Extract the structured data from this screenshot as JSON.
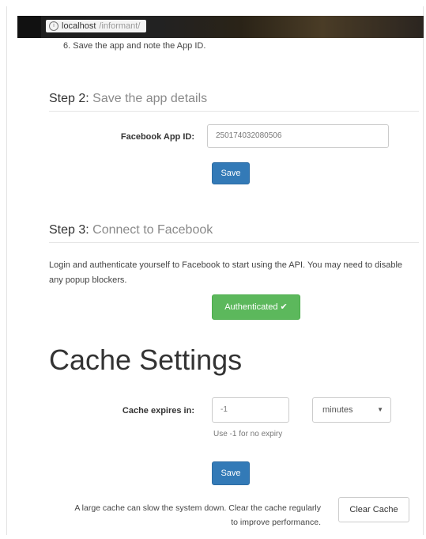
{
  "browser": {
    "url_host": "localhost",
    "url_path": "/informant/"
  },
  "step1": {
    "tail_item": "6. Save the app and note the App ID."
  },
  "step2": {
    "prefix": "Step 2:",
    "title": "Save the app details",
    "app_id_label": "Facebook App ID:",
    "app_id_value": "250174032080506",
    "save_label": "Save"
  },
  "step3": {
    "prefix": "Step 3:",
    "title": "Connect to Facebook",
    "description": "Login and authenticate yourself to Facebook to start using the API. You may need to disable any popup blockers.",
    "status_label": "Authenticated ✔"
  },
  "cache": {
    "title": "Cache Settings",
    "expires_label": "Cache expires in:",
    "expires_value": "-1",
    "unit_selected": "minutes",
    "help": "Use -1 for no expiry",
    "save_label": "Save",
    "note": "A large cache can slow the system down. Clear the cache regularly to improve performance.",
    "clear_label": "Clear Cache"
  },
  "colors": {
    "primary": "#337ab7",
    "success": "#5cb85c"
  },
  "icons": {
    "caret": "caret-down-icon",
    "check": "checkmark-icon",
    "info": "info-icon"
  }
}
